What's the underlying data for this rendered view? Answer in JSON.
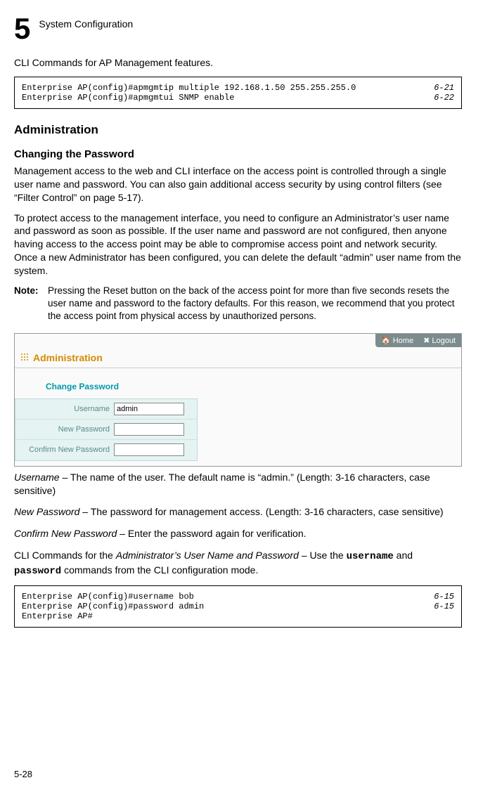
{
  "chapter": {
    "number": "5",
    "title": "System Configuration"
  },
  "intro1": "CLI Commands for AP Management features.",
  "cli1": {
    "left": "Enterprise AP(config)#apmgmtip multiple 192.168.1.50 255.255.255.0\nEnterprise AP(config)#apmgmtui SNMP enable",
    "right": "6-21\n6-22"
  },
  "section_h2": "Administration",
  "section_h3": "Changing the Password",
  "para1": "Management access to the web and CLI interface on the access point is controlled through a single user name and password. You can also gain additional access security by using control filters (see “Filter Control” on page 5-17).",
  "para2": "To protect access to the management interface, you need to configure an Administrator’s user name and password as soon as possible. If the user name and password are not configured, then anyone having access to the access point may be able to compromise access point and network security. Once a new Administrator has been configured, you can delete the default “admin” user name from the system.",
  "note_label": "Note:",
  "note_text": "Pressing the Reset button on the back of the access point for more than five seconds resets the user name and password to the factory defaults. For this reason, we recommend that you protect the access point from physical access by unauthorized persons.",
  "screenshot": {
    "topbar_home": "Home",
    "topbar_logout": "Logout",
    "title": "Administration",
    "subtitle": "Change Password",
    "rows": [
      {
        "label": "Username",
        "value": "admin",
        "type": "text"
      },
      {
        "label": "New Password",
        "value": "",
        "type": "password"
      },
      {
        "label": "Confirm New Password",
        "value": "",
        "type": "password"
      }
    ]
  },
  "field_username": {
    "term": "Username",
    "desc": " – The name of the user. The default name is “admin.” (Length: 3-16 characters, case sensitive)"
  },
  "field_newpass": {
    "term": "New Password",
    "desc": " – The password for management access. (Length: 3-16 characters, case sensitive)"
  },
  "field_confirm": {
    "term": "Confirm New Password",
    "desc": " – Enter the password again for verification."
  },
  "cli_intro_pre": "CLI Commands for the ",
  "cli_intro_italic": "Administrator’s User Name and Password",
  "cli_intro_mid": " – Use the ",
  "cli_intro_cmd1": "username",
  "cli_intro_and": " and ",
  "cli_intro_cmd2": "password",
  "cli_intro_post": " commands from the CLI configuration mode.",
  "cli2": {
    "left": "Enterprise AP(config)#username bob\nEnterprise AP(config)#password admin\nEnterprise AP#",
    "right": "6-15\n6-15\n "
  },
  "page_number": "5-28"
}
